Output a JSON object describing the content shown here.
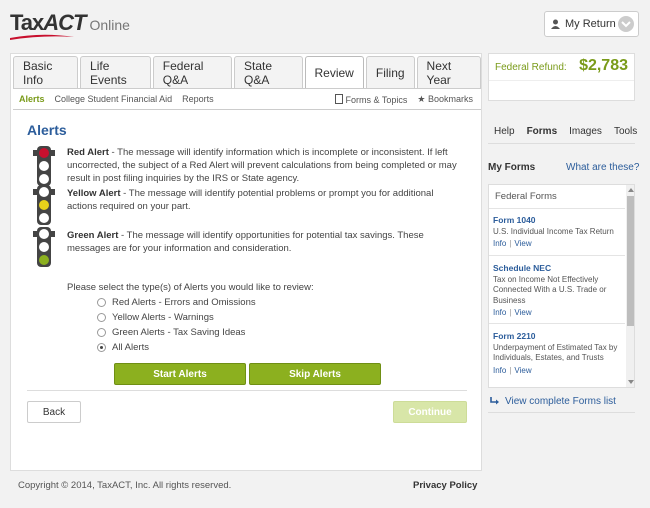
{
  "header": {
    "logo_tax": "Tax",
    "logo_act": "ACT",
    "logo_online": "Online",
    "my_return_label": "My Return",
    "brand_color": "#c8102e"
  },
  "tabs": [
    {
      "label": "Basic Info",
      "active": false
    },
    {
      "label": "Life Events",
      "active": false
    },
    {
      "label": "Federal Q&A",
      "active": false
    },
    {
      "label": "State Q&A",
      "active": false
    },
    {
      "label": "Review",
      "active": true
    },
    {
      "label": "Filing",
      "active": false
    },
    {
      "label": "Next Year",
      "active": false
    }
  ],
  "subnav": {
    "items": [
      "Alerts",
      "College Student Financial Aid",
      "Reports"
    ],
    "forms_topics": "Forms & Topics",
    "bookmarks": "Bookmarks"
  },
  "alerts": {
    "title": "Alerts",
    "red": {
      "name": "Red Alert",
      "text": " - The message will identify information which is incomplete or inconsistent. If left uncorrected, the subject of a Red Alert will prevent calculations from being completed or may result in post filing inquiries by the IRS or State agency."
    },
    "yellow": {
      "name": "Yellow Alert",
      "text": " - The message will identify potential problems or prompt you for additional actions required on your part."
    },
    "green": {
      "name": "Green Alert",
      "text": " - The message will identify opportunities for potential tax savings. These messages are for your information and consideration."
    },
    "select_prompt": "Please select the type(s) of Alerts you would like to review:",
    "options": [
      {
        "label": "Red Alerts - Errors and Omissions",
        "selected": false
      },
      {
        "label": "Yellow Alerts - Warnings",
        "selected": false
      },
      {
        "label": "Green Alerts - Tax Saving Ideas",
        "selected": false
      },
      {
        "label": "All Alerts",
        "selected": true
      }
    ],
    "start_label": "Start Alerts",
    "skip_label": "Skip Alerts"
  },
  "nav": {
    "back_label": "Back",
    "continue_label": "Continue"
  },
  "footer": {
    "copyright": "Copyright © 2014, TaxACT, Inc. All rights reserved.",
    "privacy": "Privacy Policy"
  },
  "refund": {
    "label": "Federal Refund:",
    "value": "$2,783"
  },
  "side_tabs": [
    {
      "label": "Help",
      "active": false
    },
    {
      "label": "Forms",
      "active": true
    },
    {
      "label": "Images",
      "active": false
    },
    {
      "label": "Tools",
      "active": false
    }
  ],
  "forms_panel": {
    "title": "My Forms",
    "what_link": "What are these?",
    "section": "Federal Forms",
    "items": [
      {
        "name": "Form 1040",
        "desc": "U.S. Individual Income Tax Return",
        "info": "Info",
        "view": "View"
      },
      {
        "name": "Schedule NEC",
        "desc": "Tax on Income Not Effectively Connected With a U.S. Trade or Business",
        "info": "Info",
        "view": "View"
      },
      {
        "name": "Form 2210",
        "desc": "Underpayment of Estimated Tax by Individuals, Estates, and Trusts",
        "info": "Info",
        "view": "View"
      }
    ],
    "view_complete": "View complete Forms list"
  }
}
